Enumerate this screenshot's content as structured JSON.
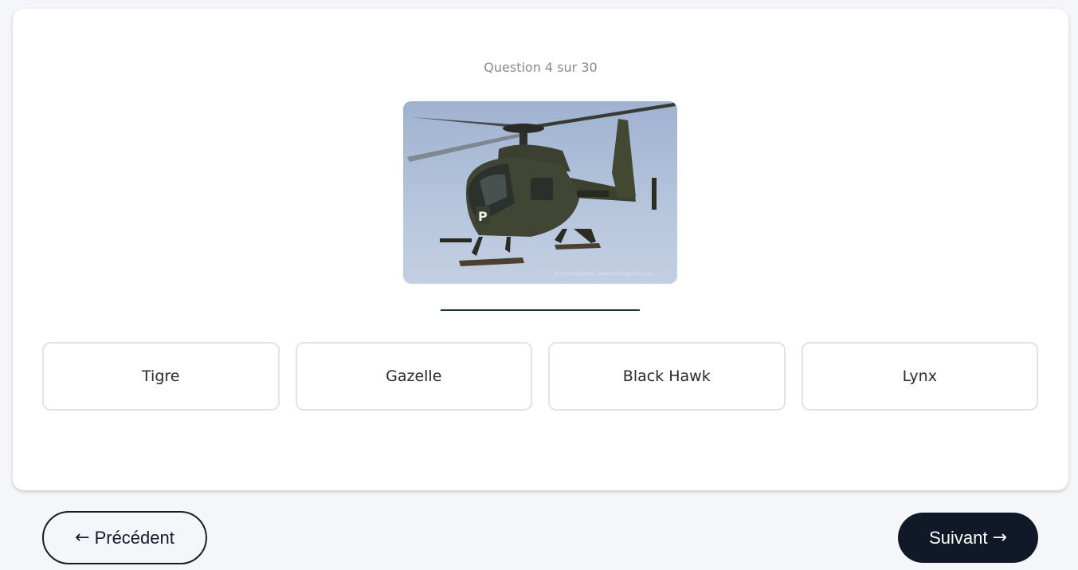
{
  "quiz": {
    "counter": "Question 4 sur 30",
    "image": {
      "subject": "helicopter-photo",
      "tail_marking": "P",
      "watermark": "© André Jérôme · www.helicospotter.com"
    },
    "options": [
      "Tigre",
      "Gazelle",
      "Black Hawk",
      "Lynx"
    ]
  },
  "nav": {
    "prev_arrow": "←",
    "prev_label": "Précédent",
    "next_label": "Suivant",
    "next_arrow": "→"
  },
  "colors": {
    "background": "#f4f6fa",
    "card": "#ffffff",
    "accent_dark": "#111827",
    "underline": "#1f3a3d"
  }
}
